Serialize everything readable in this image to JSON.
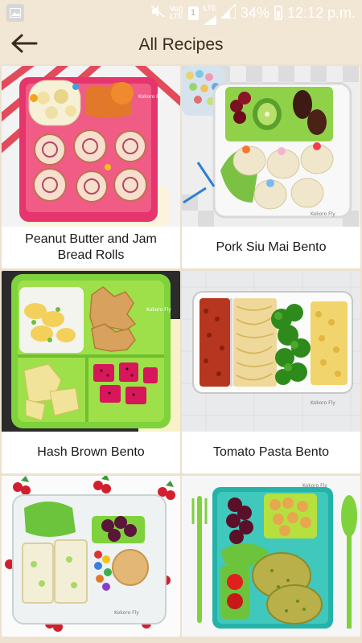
{
  "status_bar": {
    "volte_label": "Vo))\nLTE",
    "sim_label": "1",
    "lte_label": "LTE",
    "battery_percent": "34%",
    "time": "12:12 p.m."
  },
  "app_bar": {
    "back_icon": "arrow-left-icon",
    "title": "All Recipes"
  },
  "recipes": [
    {
      "name": "Peanut Butter and Jam Bread Rolls",
      "watermark": "Kokoro Fly"
    },
    {
      "name": "Pork Siu Mai Bento",
      "watermark": "Kokoro Fly"
    },
    {
      "name": "Hash Brown Bento",
      "watermark": "Kokoro Fly"
    },
    {
      "name": "Tomato Pasta Bento",
      "watermark": "Kokoro Fly"
    },
    {
      "name": "",
      "watermark": "Kokoro Fly"
    },
    {
      "name": "",
      "watermark": "Kokoro Fly"
    }
  ],
  "colors": {
    "app_bar_bg": "#f2e6d4",
    "title_color": "#3b2a20",
    "card_bg": "#ffffff"
  }
}
